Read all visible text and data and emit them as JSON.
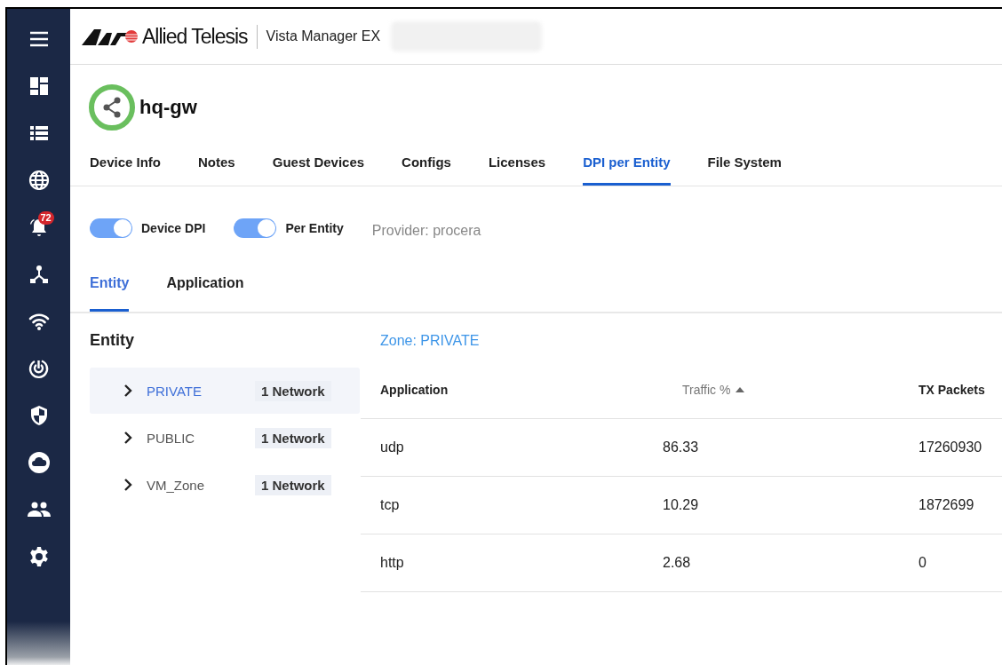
{
  "sidebar": {
    "items": [
      {
        "kind": "menu"
      },
      {
        "kind": "dashboard"
      },
      {
        "kind": "list"
      },
      {
        "kind": "globe"
      },
      {
        "kind": "alarm",
        "badge": "72"
      },
      {
        "kind": "topology"
      },
      {
        "kind": "wifi"
      },
      {
        "kind": "radar"
      },
      {
        "kind": "shield"
      },
      {
        "kind": "cloud"
      },
      {
        "kind": "people"
      },
      {
        "kind": "settings"
      }
    ]
  },
  "header": {
    "brand": "Allied Telesis",
    "product": "Vista Manager EX"
  },
  "device": {
    "name": "hq-gw"
  },
  "tabs": [
    {
      "label": "Device Info",
      "selected": false
    },
    {
      "label": "Notes",
      "selected": false
    },
    {
      "label": "Guest Devices",
      "selected": false
    },
    {
      "label": "Configs",
      "selected": false
    },
    {
      "label": "Licenses",
      "selected": false
    },
    {
      "label": "DPI per Entity",
      "selected": true
    },
    {
      "label": "File System",
      "selected": false
    }
  ],
  "toggles": [
    {
      "label": "Device DPI",
      "on": true
    },
    {
      "label": "Per Entity",
      "on": true
    }
  ],
  "provider": "Provider: procera",
  "subtabs": [
    {
      "label": "Entity",
      "selected": true
    },
    {
      "label": "Application",
      "selected": false
    }
  ],
  "entity_panel": {
    "title": "Entity",
    "items": [
      {
        "name": "PRIVATE",
        "count": "1 Network",
        "selected": true,
        "expanded": false
      },
      {
        "name": "PUBLIC",
        "count": "1 Network",
        "selected": false,
        "expanded": false
      },
      {
        "name": "VM_Zone",
        "count": "1 Network",
        "selected": false,
        "expanded": false
      }
    ]
  },
  "table": {
    "title": "Zone: PRIVATE",
    "columns": [
      {
        "label": "Application",
        "sorted": false
      },
      {
        "label": "Traffic %",
        "sorted": true
      },
      {
        "label": "TX Packets",
        "sorted": false
      }
    ],
    "rows": [
      [
        "udp",
        "86.33",
        "17260930"
      ],
      [
        "tcp",
        "10.29",
        "1872699"
      ],
      [
        "http",
        "2.68",
        "0"
      ]
    ]
  }
}
